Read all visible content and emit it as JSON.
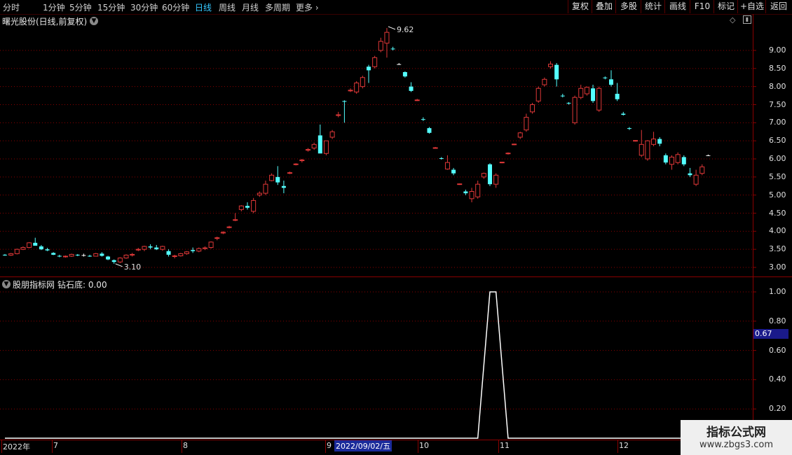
{
  "toolbar": {
    "periods": [
      "分时",
      "1分钟",
      "5分钟",
      "15分钟",
      "30分钟",
      "60分钟",
      "日线",
      "周线",
      "月线",
      "多周期",
      "更多"
    ],
    "active_period": "日线",
    "tools": [
      "复权",
      "叠加",
      "多股",
      "统计",
      "画线",
      "F10",
      "标记",
      "+自选",
      "返回"
    ]
  },
  "main_panel": {
    "title": "曙光股份(日线,前复权)"
  },
  "sub_panel": {
    "title": "股朋指标网",
    "indicator_label": "钻石底: 0.00"
  },
  "current_value_box": "0.67",
  "date_box": "2022/09/02/五",
  "watermark": {
    "line1": "指标公式网",
    "line2": "www.zbgs3.com"
  },
  "colors": {
    "up": "#e03838",
    "down": "#54ffff",
    "flat": "#ffffff",
    "grid": "#8b0000",
    "axis": "#8b0000"
  },
  "chart_data": [
    {
      "type": "candlestick",
      "title": "曙光股份(日线,前复权)",
      "ylim": [
        2.85,
        10.0
      ],
      "y_ticks": [
        "9.00",
        "8.50",
        "8.00",
        "7.50",
        "7.00",
        "6.50",
        "6.00",
        "5.50",
        "5.00",
        "4.50",
        "4.00",
        "3.50",
        "3.00"
      ],
      "x_ticks": [
        "2022年",
        "7",
        "8",
        "9",
        "10",
        "11",
        "12"
      ],
      "annotations": [
        {
          "label": "9.62"
        },
        {
          "label": "3.10"
        }
      ],
      "candles": [
        [
          3.35,
          3.37,
          3.32,
          3.34
        ],
        [
          3.34,
          3.4,
          3.32,
          3.38
        ],
        [
          3.38,
          3.52,
          3.36,
          3.5
        ],
        [
          3.5,
          3.58,
          3.48,
          3.55
        ],
        [
          3.55,
          3.7,
          3.53,
          3.68
        ],
        [
          3.68,
          3.82,
          3.66,
          3.6
        ],
        [
          3.58,
          3.62,
          3.48,
          3.5
        ],
        [
          3.5,
          3.54,
          3.45,
          3.47
        ],
        [
          3.4,
          3.42,
          3.34,
          3.35
        ],
        [
          3.32,
          3.35,
          3.28,
          3.3
        ],
        [
          3.3,
          3.33,
          3.27,
          3.31
        ],
        [
          3.31,
          3.38,
          3.29,
          3.36
        ],
        [
          3.35,
          3.37,
          3.31,
          3.33
        ],
        [
          3.34,
          3.38,
          3.3,
          3.34
        ],
        [
          3.32,
          3.35,
          3.29,
          3.31
        ],
        [
          3.31,
          3.4,
          3.3,
          3.38
        ],
        [
          3.38,
          3.42,
          3.3,
          3.32
        ],
        [
          3.3,
          3.32,
          3.2,
          3.22
        ],
        [
          3.2,
          3.22,
          3.1,
          3.15
        ],
        [
          3.15,
          3.28,
          3.12,
          3.26
        ],
        [
          3.26,
          3.36,
          3.24,
          3.34
        ],
        [
          3.34,
          3.4,
          3.3,
          3.36
        ],
        [
          3.48,
          3.54,
          3.45,
          3.5
        ],
        [
          3.5,
          3.6,
          3.45,
          3.58
        ],
        [
          3.58,
          3.64,
          3.5,
          3.55
        ],
        [
          3.55,
          3.62,
          3.48,
          3.5
        ],
        [
          3.5,
          3.6,
          3.46,
          3.58
        ],
        [
          3.45,
          3.5,
          3.3,
          3.35
        ],
        [
          3.3,
          3.35,
          3.25,
          3.32
        ],
        [
          3.32,
          3.4,
          3.3,
          3.38
        ],
        [
          3.38,
          3.45,
          3.35,
          3.43
        ],
        [
          3.48,
          3.55,
          3.4,
          3.45
        ],
        [
          3.45,
          3.55,
          3.42,
          3.52
        ],
        [
          3.52,
          3.58,
          3.48,
          3.54
        ],
        [
          3.55,
          3.72,
          3.52,
          3.7
        ],
        [
          3.8,
          3.85,
          3.75,
          3.82
        ],
        [
          3.95,
          4.0,
          3.92,
          3.97
        ],
        [
          4.1,
          4.15,
          4.08,
          4.12
        ],
        [
          4.3,
          4.5,
          4.28,
          4.32
        ],
        [
          4.6,
          4.72,
          4.55,
          4.7
        ],
        [
          4.7,
          4.8,
          4.6,
          4.65
        ],
        [
          4.55,
          4.92,
          4.5,
          4.85
        ],
        [
          5.0,
          5.1,
          4.95,
          5.05
        ],
        [
          5.05,
          5.4,
          5.0,
          5.3
        ],
        [
          5.4,
          5.6,
          5.38,
          5.55
        ],
        [
          5.5,
          5.8,
          5.28,
          5.35
        ],
        [
          5.25,
          5.4,
          5.05,
          5.2
        ],
        [
          5.6,
          5.65,
          5.58,
          5.62
        ],
        [
          5.85,
          5.88,
          5.82,
          5.86
        ],
        [
          5.95,
          6.0,
          5.9,
          5.97
        ],
        [
          6.25,
          6.3,
          6.2,
          6.26
        ],
        [
          6.3,
          6.45,
          6.25,
          6.4
        ],
        [
          6.65,
          6.95,
          6.6,
          6.15
        ],
        [
          6.15,
          6.5,
          6.1,
          6.5
        ],
        [
          6.6,
          6.8,
          6.55,
          6.75
        ],
        [
          7.2,
          7.3,
          7.15,
          7.22
        ],
        [
          7.6,
          7.62,
          7.0,
          7.58
        ],
        [
          7.88,
          7.95,
          7.85,
          7.9
        ],
        [
          7.85,
          8.15,
          7.8,
          8.1
        ],
        [
          8.0,
          8.3,
          7.95,
          8.25
        ],
        [
          8.55,
          8.6,
          8.1,
          8.45
        ],
        [
          8.55,
          8.85,
          8.5,
          8.8
        ],
        [
          9.0,
          9.35,
          8.95,
          9.25
        ],
        [
          9.2,
          9.62,
          8.8,
          9.5
        ],
        [
          9.05,
          9.1,
          9.0,
          9.04
        ],
        [
          8.62,
          8.65,
          8.6,
          8.62
        ],
        [
          8.4,
          8.42,
          8.25,
          8.28
        ],
        [
          8.0,
          8.12,
          7.85,
          7.88
        ],
        [
          7.62,
          7.66,
          7.6,
          7.63
        ],
        [
          7.1,
          7.15,
          7.05,
          7.08
        ],
        [
          6.85,
          6.88,
          6.7,
          6.72
        ],
        [
          6.3,
          6.33,
          6.28,
          6.31
        ],
        [
          6.02,
          6.05,
          5.98,
          6.01
        ],
        [
          5.72,
          6.1,
          5.7,
          5.9
        ],
        [
          5.7,
          5.75,
          5.55,
          5.6
        ],
        [
          5.3,
          5.32,
          5.28,
          5.31
        ],
        [
          5.1,
          5.15,
          5.0,
          5.05
        ],
        [
          4.9,
          5.2,
          4.8,
          5.1
        ],
        [
          4.95,
          5.4,
          4.9,
          5.3
        ],
        [
          5.5,
          5.62,
          5.45,
          5.6
        ],
        [
          5.85,
          5.88,
          5.25,
          5.3
        ],
        [
          5.3,
          5.6,
          5.2,
          5.55
        ],
        [
          5.9,
          5.92,
          5.88,
          5.91
        ],
        [
          6.15,
          6.18,
          6.12,
          6.16
        ],
        [
          6.4,
          6.42,
          6.38,
          6.41
        ],
        [
          6.6,
          6.75,
          6.55,
          6.72
        ],
        [
          6.8,
          7.25,
          6.75,
          7.15
        ],
        [
          7.3,
          7.55,
          7.25,
          7.5
        ],
        [
          7.6,
          8.0,
          7.55,
          7.95
        ],
        [
          8.05,
          8.25,
          8.0,
          8.2
        ],
        [
          8.55,
          8.7,
          8.5,
          8.62
        ],
        [
          8.6,
          8.65,
          8.0,
          8.2
        ],
        [
          7.75,
          7.8,
          7.7,
          7.73
        ],
        [
          7.55,
          7.57,
          7.5,
          7.54
        ],
        [
          7.0,
          7.75,
          6.95,
          7.7
        ],
        [
          7.7,
          8.05,
          7.65,
          7.95
        ],
        [
          7.8,
          8.0,
          7.75,
          7.98
        ],
        [
          7.95,
          8.05,
          7.55,
          7.6
        ],
        [
          7.35,
          8.0,
          7.3,
          7.95
        ],
        [
          8.25,
          8.28,
          8.2,
          8.24
        ],
        [
          8.2,
          8.45,
          8.0,
          8.05
        ],
        [
          7.8,
          8.1,
          7.6,
          7.65
        ],
        [
          7.25,
          7.3,
          7.2,
          7.22
        ],
        [
          6.85,
          6.88,
          6.8,
          6.84
        ],
        [
          6.5,
          6.52,
          6.48,
          6.51
        ],
        [
          6.1,
          6.8,
          6.05,
          6.4
        ],
        [
          6.0,
          6.52,
          5.95,
          6.5
        ],
        [
          6.4,
          6.75,
          6.35,
          6.55
        ],
        [
          6.55,
          6.6,
          6.35,
          6.42
        ],
        [
          6.1,
          6.15,
          5.85,
          5.9
        ],
        [
          5.85,
          6.1,
          5.7,
          6.05
        ],
        [
          5.9,
          6.18,
          5.85,
          6.12
        ],
        [
          6.05,
          6.1,
          5.8,
          5.85
        ],
        [
          5.6,
          5.75,
          5.5,
          5.55
        ],
        [
          5.3,
          5.7,
          5.25,
          5.55
        ],
        [
          5.6,
          5.85,
          5.55,
          5.78
        ],
        [
          6.1,
          6.12,
          6.08,
          6.1
        ]
      ]
    },
    {
      "type": "line",
      "title": "钻石底",
      "ylim": [
        0,
        1.05
      ],
      "y_ticks": [
        "1.00",
        "0.80",
        "0.60",
        "0.40",
        "0.20"
      ],
      "series": [
        {
          "name": "钻石底",
          "points": [
            [
              0,
              0
            ],
            [
              78,
              0
            ],
            [
              80,
              1
            ],
            [
              81,
              1
            ],
            [
              83,
              0
            ],
            [
              115,
              0
            ]
          ]
        }
      ]
    }
  ]
}
